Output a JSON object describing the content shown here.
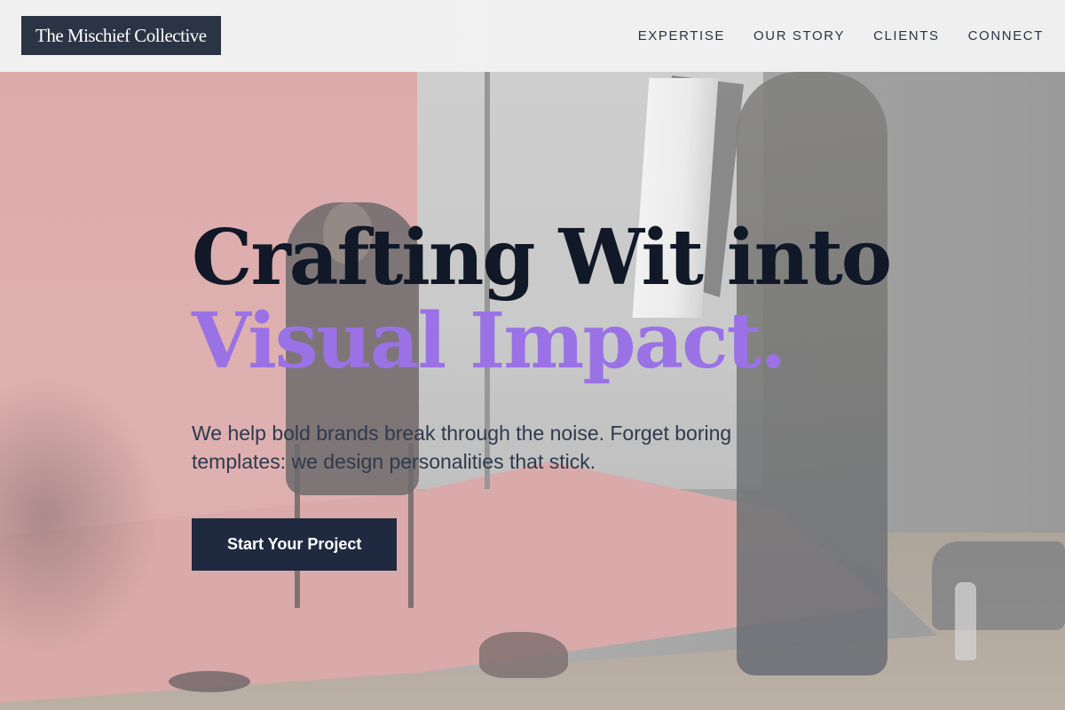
{
  "brand": {
    "logo_text": "The Mischief Collective"
  },
  "nav": {
    "items": [
      {
        "label": "EXPERTISE"
      },
      {
        "label": "OUR STORY"
      },
      {
        "label": "CLIENTS"
      },
      {
        "label": "CONNECT"
      }
    ]
  },
  "hero": {
    "headline_line1": "Crafting Wit into",
    "headline_line2": "Visual Impact.",
    "subtitle": "We help bold brands break through the noise. Forget boring templates: we design personalities that stick.",
    "cta_label": "Start Your Project"
  },
  "colors": {
    "logo_bg": "#2b3444",
    "headline_dark": "#111827",
    "headline_accent": "#9a72e6",
    "cta_bg": "#1f2a40"
  }
}
